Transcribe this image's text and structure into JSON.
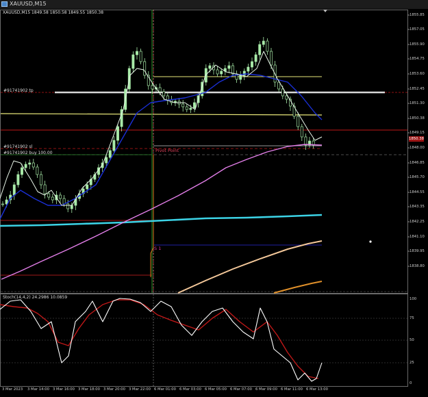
{
  "window": {
    "title": "XAUUSD,M15",
    "chart_header": "XAUUSD,M15  1849.58 1850.58 1849.55 1850.38"
  },
  "main": {
    "price_ticks": [
      "1855.85",
      "1857.05",
      "1855.90",
      "1854.75",
      "1853.60",
      "1852.45",
      "1851.30",
      "1850.38",
      "1849.15",
      "1848.00",
      "1846.85",
      "1845.70",
      "1844.55",
      "1843.35",
      "1842.25",
      "1841.10",
      "1839.95",
      "1838.80"
    ],
    "current_price": "1850.38",
    "order_labels": {
      "tp": "#91741902 tp",
      "sl": "#91741902 sl",
      "buy": "#91741902 buy 100.00"
    },
    "pivot_label": "Pivot Point",
    "s1_label": "S 1"
  },
  "sub": {
    "header": "Stoch(14,4,2) 24.2986 10.0859",
    "levels": [
      "100",
      "75",
      "50",
      "25",
      "0"
    ]
  },
  "time_axis": [
    "3 Mar 2023",
    "3 Mar 14:00",
    "3 Mar 16:00",
    "3 Mar 18:00",
    "3 Mar 20:00",
    "3 Mar 22:00",
    "6 Mar 01:00",
    "6 Mar 03:00",
    "6 Mar 05:00",
    "6 Mar 07:00",
    "6 Mar 09:00",
    "6 Mar 11:00",
    "6 Mar 13:00"
  ],
  "colors": {
    "candles": "#a8eaa8",
    "ma_fast": "#e8f5e8",
    "ma_blue": "#1a2fd6",
    "ma_magenta": "#e27ee8",
    "ma_cyan": "#3cd3e6",
    "ma_peach": "#f4c89a",
    "ma_orange": "#e0902a",
    "tp_line": "#d7d7d7",
    "yellow_level": "#e9e87a",
    "red_level": "#c01818",
    "stoch_main": "#ffffff",
    "stoch_signal": "#c01818"
  }
}
